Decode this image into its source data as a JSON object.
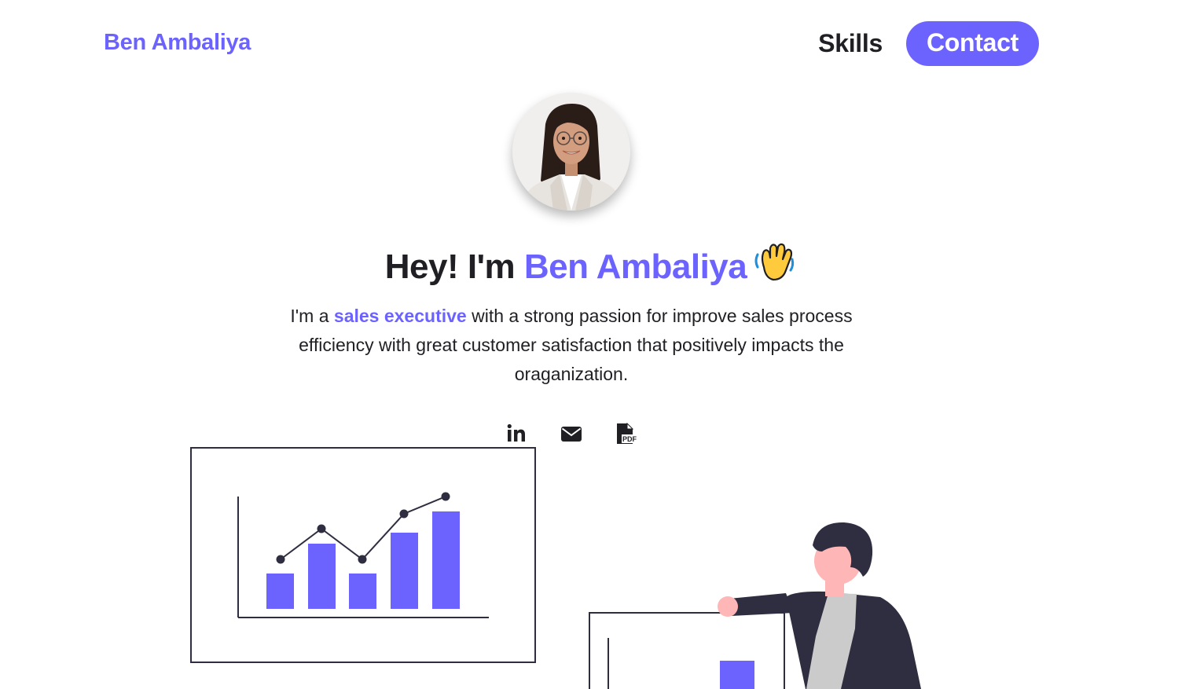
{
  "header": {
    "brand": "Ben Ambaliya",
    "nav": {
      "skills": "Skills",
      "contact": "Contact"
    }
  },
  "hero": {
    "greeting": "Hey! I'm ",
    "name": "Ben Ambaliya",
    "wave_icon": "waving-hand-icon",
    "intro_prefix": "I'm a ",
    "intro_role": "sales executive",
    "intro_rest": " with a strong passion for improve sales process efficiency with great customer satisfaction that positively impacts the oraganization."
  },
  "socials": [
    {
      "icon": "linkedin-icon",
      "label": "in"
    },
    {
      "icon": "envelope-icon"
    },
    {
      "icon": "pdf-file-icon",
      "label": "PDF"
    }
  ],
  "colors": {
    "accent": "#6c63ff",
    "text": "#1f1f24",
    "illustration_dark": "#2f2e41",
    "skin": "#ffb6b6",
    "shirt": "#cbcbcb"
  }
}
